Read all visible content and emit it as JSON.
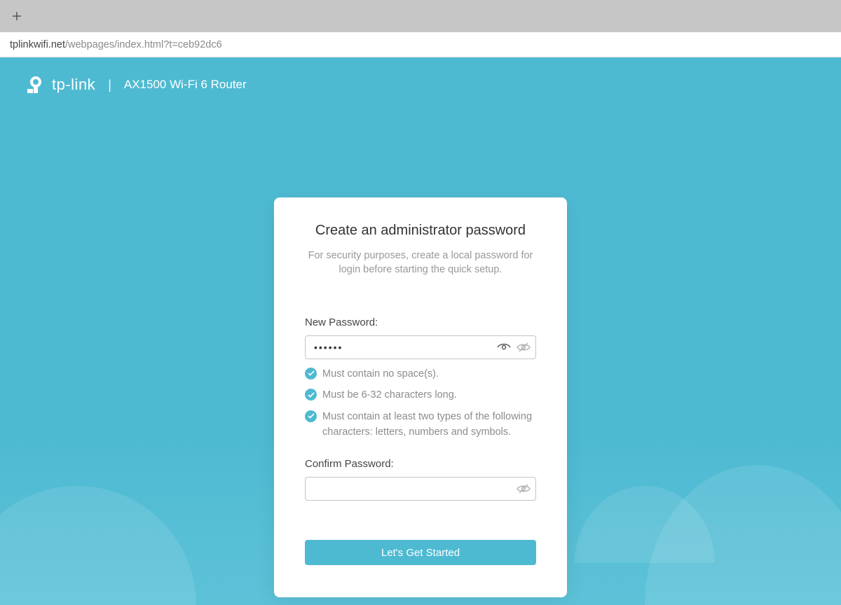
{
  "browser": {
    "url_host": "tplinkwifi.net",
    "url_path": "/webpages/index.html?t=ceb92dc6"
  },
  "header": {
    "brand": "tp-link",
    "product": "AX1500 Wi-Fi 6 Router"
  },
  "card": {
    "title": "Create an administrator password",
    "subtitle": "For security purposes, create a local password for login before starting the quick setup.",
    "new_password_label": "New Password:",
    "new_password_value": "••••••",
    "requirements": [
      "Must contain no space(s).",
      "Must be 6-32 characters long.",
      "Must contain at least two types of the following characters: letters, numbers and symbols."
    ],
    "confirm_password_label": "Confirm Password:",
    "confirm_password_value": "",
    "submit_label": "Let's Get Started"
  },
  "colors": {
    "accent": "#4ebad2"
  }
}
